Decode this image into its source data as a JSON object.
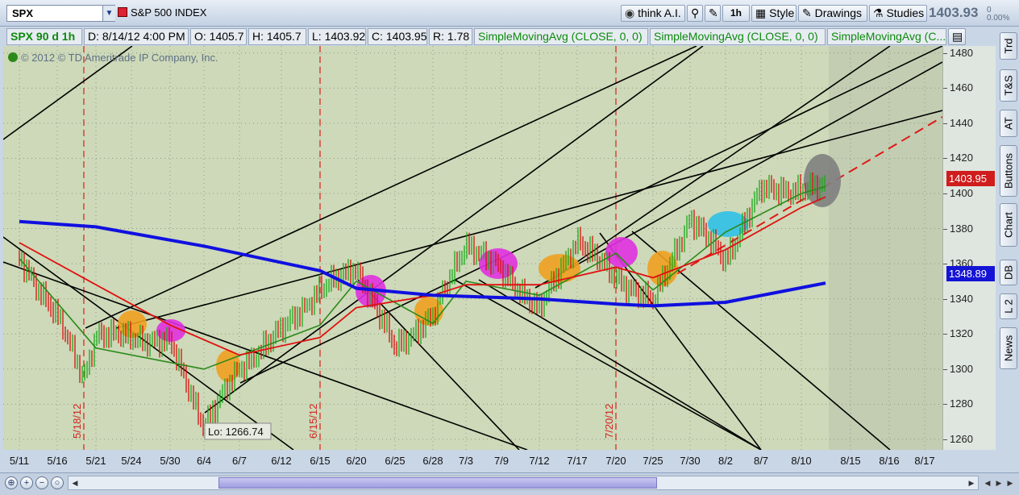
{
  "toolbar": {
    "symbol": "SPX",
    "symbol_name": "S&P 500 INDEX",
    "think_ai": "think A.I.",
    "interval": "1h",
    "style": "Style",
    "drawings": "Drawings",
    "studies": "Studies",
    "last_price": "1403.93",
    "change_top": "0",
    "change_bottom": "0.00%"
  },
  "infobar": {
    "title": "SPX 90 d 1h",
    "date": "D: 8/14/12 4:00 PM",
    "open": "O: 1405.7",
    "high": "H: 1405.7",
    "low": "L: 1403.92",
    "close": "C: 1403.95",
    "range": "R: 1.78",
    "sma1": "SimpleMovingAvg (CLOSE, 0, 0)",
    "sma2": "SimpleMovingAvg (CLOSE, 0, 0)",
    "sma3": "SimpleMovingAvg (C..."
  },
  "chart": {
    "copyright": "© 2012 © TD Ameritrade IP Company, Inc.",
    "lo_label": "Lo: 1266.74",
    "price_tag_close": "1403.95",
    "price_tag_sma200": "1348.89",
    "vertical_markers": [
      "5/18/12",
      "6/15/12",
      "7/20/12"
    ],
    "colors": {
      "background": "#cdd9b8",
      "sma_blue": "#1010e0",
      "sma_red": "#e01010",
      "sma_green": "#2c8a1a",
      "candle_up": "#1aaa1a",
      "candle_down": "#d81010"
    }
  },
  "chart_data": {
    "type": "line",
    "title": "",
    "x_labels": [
      "5/11",
      "5/16",
      "5/21",
      "5/24",
      "5/30",
      "6/4",
      "6/7",
      "6/12",
      "6/15",
      "6/20",
      "6/25",
      "6/28",
      "7/3",
      "7/9",
      "7/12",
      "7/17",
      "7/20",
      "7/25",
      "7/30",
      "8/2",
      "8/7",
      "8/10",
      "8/15",
      "8/16",
      "8/17"
    ],
    "y_ticks": [
      1480,
      1460,
      1440,
      1420,
      1400,
      1380,
      1360,
      1340,
      1320,
      1300,
      1280,
      1260
    ],
    "ylim": [
      1254,
      1484
    ],
    "series": [
      {
        "x": [
          "5/11",
          "5/16",
          "5/18",
          "5/21",
          "5/24",
          "5/30",
          "6/4",
          "6/7",
          "6/12",
          "6/15",
          "6/20",
          "6/25",
          "6/28",
          "7/3",
          "7/9",
          "7/12",
          "7/17",
          "7/20",
          "7/25",
          "7/30",
          "8/2",
          "8/7",
          "8/10",
          "8/14"
        ],
        "values": [
          1363,
          1330,
          1295,
          1320,
          1318,
          1315,
          1268,
          1300,
          1322,
          1345,
          1358,
          1312,
          1330,
          1372,
          1356,
          1334,
          1374,
          1352,
          1338,
          1386,
          1362,
          1402,
          1402,
          1404
        ]
      },
      {
        "x": [
          "5/11",
          "5/21",
          "6/4",
          "6/15",
          "6/20",
          "6/28",
          "7/3",
          "7/12",
          "7/20",
          "7/25",
          "8/2",
          "8/10",
          "8/14"
        ],
        "values": [
          1363,
          1312,
          1300,
          1325,
          1350,
          1326,
          1350,
          1342,
          1366,
          1345,
          1378,
          1400,
          1404
        ]
      },
      {
        "x": [
          "5/11",
          "5/21",
          "5/30",
          "6/7",
          "6/15",
          "6/20",
          "6/28",
          "7/3",
          "7/12",
          "7/20",
          "7/25",
          "8/2",
          "8/10",
          "8/14"
        ],
        "values": [
          1372,
          1348,
          1325,
          1308,
          1318,
          1335,
          1342,
          1348,
          1348,
          1358,
          1352,
          1368,
          1392,
          1398
        ]
      },
      {
        "x": [
          "5/11",
          "5/21",
          "6/4",
          "6/15",
          "6/20",
          "6/28",
          "7/12",
          "7/20",
          "7/25",
          "8/2",
          "8/14"
        ],
        "values": [
          1384,
          1381,
          1370,
          1356,
          1346,
          1342,
          1340,
          1337,
          1336,
          1338,
          1349
        ]
      }
    ]
  },
  "side_tabs": [
    "Trd",
    "T&S",
    "AT",
    "Buttons",
    "Chart",
    "DB",
    "L 2",
    "News"
  ],
  "bottombar": {
    "zoom_fit": "⊕",
    "zoom_in": "+",
    "zoom_out": "−",
    "zoom_reset": "○"
  }
}
